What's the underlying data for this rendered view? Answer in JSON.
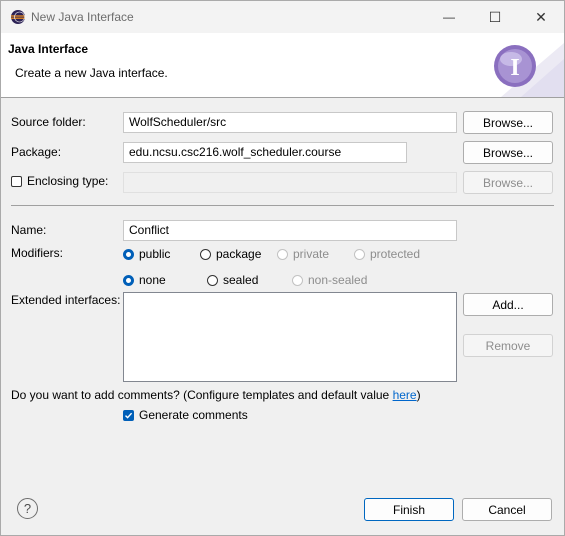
{
  "window": {
    "title": "New Java Interface",
    "controls": {
      "minimize": "—",
      "maximize": "☐",
      "close": "✕"
    }
  },
  "header": {
    "title": "Java Interface",
    "description": "Create a new Java interface.",
    "icon_letter": "I"
  },
  "form": {
    "source_folder": {
      "label": "Source folder:",
      "value": "WolfScheduler/src",
      "button": "Browse..."
    },
    "package": {
      "label": "Package:",
      "value": "edu.ncsu.csc216.wolf_scheduler.course",
      "button": "Browse..."
    },
    "enclosing_type": {
      "label": "Enclosing type:",
      "value": "",
      "button": "Browse...",
      "checked": false
    },
    "name": {
      "label": "Name:",
      "value": "Conflict"
    },
    "modifiers": {
      "label": "Modifiers:",
      "access": [
        "public",
        "package",
        "private",
        "protected"
      ],
      "access_selected": "public",
      "sealing": [
        "none",
        "sealed",
        "non-sealed"
      ],
      "sealing_selected": "none"
    },
    "extended_interfaces": {
      "label": "Extended interfaces:",
      "add_button": "Add...",
      "remove_button": "Remove",
      "items": []
    },
    "comments": {
      "question_prefix": "Do you want to add comments? (Configure templates and default value ",
      "link_text": "here",
      "question_suffix": ")",
      "generate_label": "Generate comments",
      "generate_checked": true
    }
  },
  "footer": {
    "help_icon": "?",
    "finish_button": "Finish",
    "cancel_button": "Cancel"
  },
  "colors": {
    "accent": "#005fb8",
    "link": "#0066cc",
    "icon_purple": "#8a6fbf"
  }
}
